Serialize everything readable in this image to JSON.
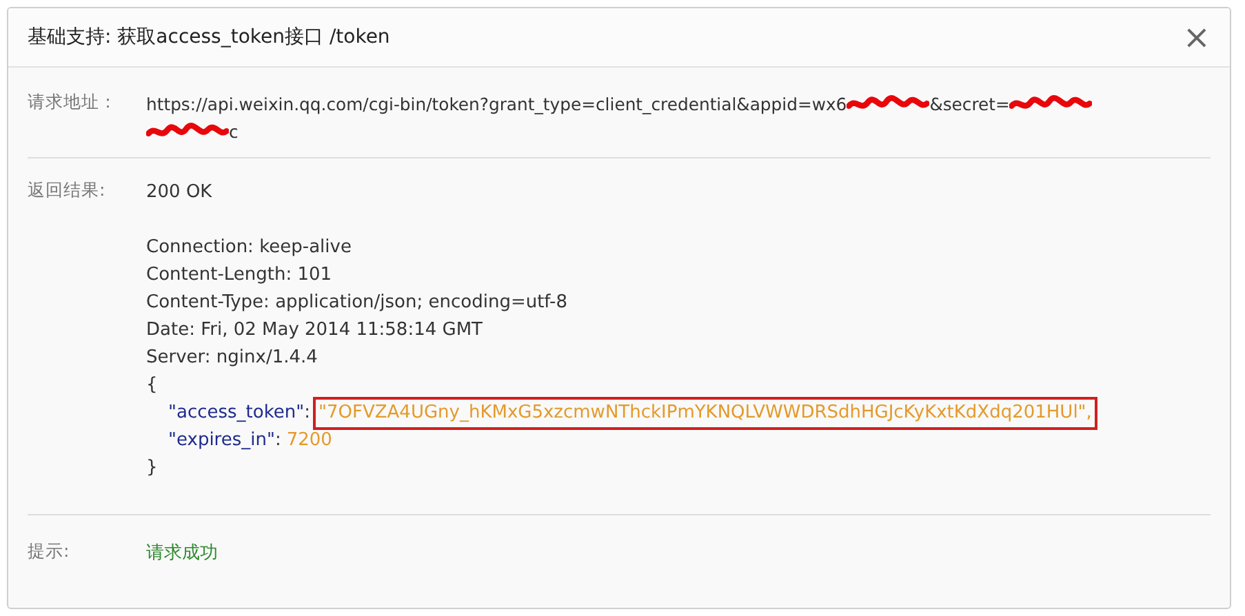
{
  "dialog": {
    "title": "基础支持: 获取access_token接口 /token",
    "close": "×"
  },
  "request": {
    "label": "请求地址：",
    "lines": [
      [
        {
          "kind": "text",
          "text": "https://api.weixin.qq.com/cgi-bin/token?grant_type=client_credential&appid=wx6"
        },
        {
          "kind": "redacted"
        },
        {
          "kind": "text",
          "text": "&secret="
        },
        {
          "kind": "redacted"
        }
      ],
      [
        {
          "kind": "redacted"
        },
        {
          "kind": "text",
          "text": "c"
        }
      ]
    ]
  },
  "result": {
    "label": "返回结果:",
    "status": "200 OK",
    "headers": [
      "Connection: keep-alive",
      "Content-Length: 101",
      "Content-Type: application/json; encoding=utf-8",
      "Date: Fri, 02 May 2014 11:58:14 GMT",
      "Server: nginx/1.4.4"
    ],
    "body": [
      {
        "kind": "brace",
        "text": "{"
      },
      {
        "kind": "pair",
        "key": "\"access_token\"",
        "punct": ":",
        "value": "\"7OFVZA4UGny_hKMxG5xzcmwNThckIPmYKNQLVWWDRSdhHGJcKyKxtKdXdq201HUl\",",
        "highlighted": true
      },
      {
        "kind": "pair",
        "key": "\"expires_in\"",
        "punct": ":",
        "value": "7200",
        "highlighted": false
      },
      {
        "kind": "brace",
        "text": "}"
      }
    ]
  },
  "tip": {
    "label": "提示:",
    "message": "请求成功"
  }
}
